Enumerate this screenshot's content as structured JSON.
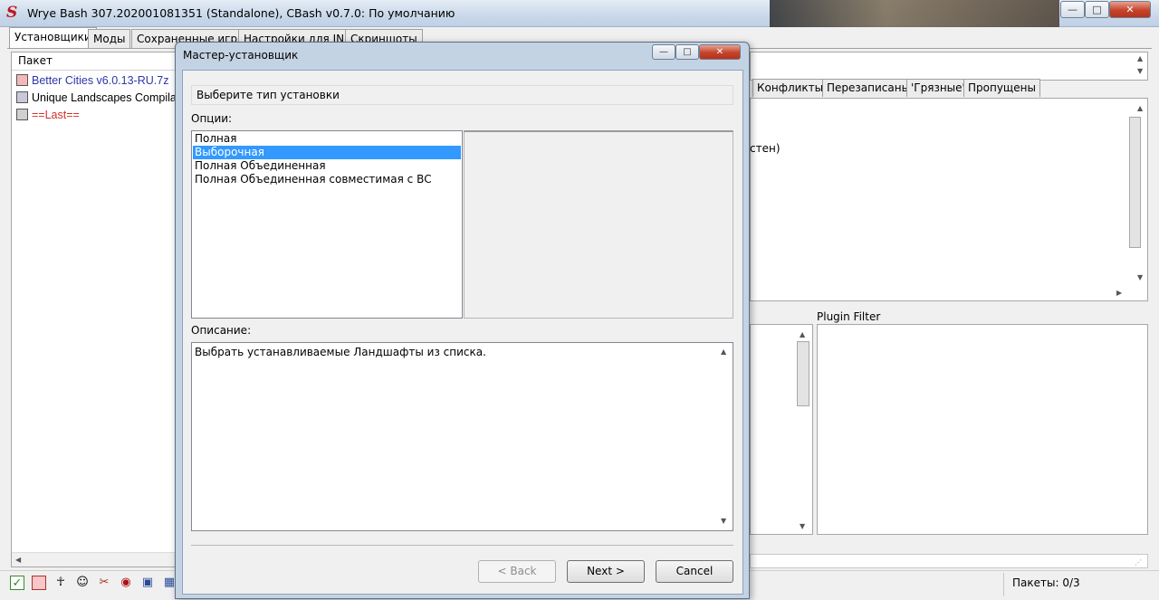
{
  "window": {
    "title": "Wrye Bash 307.202001081351 (Standalone), CBash v0.7.0: По умолчанию",
    "minimize": "—",
    "maximize": "□",
    "close": "✕"
  },
  "tabs": [
    "Установщики",
    "Моды",
    "Сохраненные игры",
    "Настройки для INI",
    "Скриншоты"
  ],
  "packages": {
    "header": "Пакет",
    "items": [
      {
        "name": "Better Cities v6.0.13-RU.7z",
        "color": "#2e36a8"
      },
      {
        "name": "Unique Landscapes Compila",
        "color": "#000000"
      },
      {
        "name": "==Last==",
        "color": "#d0302a"
      }
    ]
  },
  "right_tabs": [
    "Конфликты",
    "Перезаписаны",
    "'Грязные'",
    "Пропущены"
  ],
  "right_partial_text": "стен)",
  "plugin_filter_label": "Plugin Filter",
  "status": {
    "packages_count": "Пакеты: 0/3"
  },
  "toolbar_icons": [
    "checkbox-icon",
    "color-box-icon",
    "oblivion-icon",
    "person-icon",
    "tools-icon",
    "target-icon",
    "boss-icon",
    "tes4-icon"
  ],
  "dialog": {
    "title": "Мастер-установщик",
    "install_type_prompt": "Выберите тип установки",
    "options_label": "Опции:",
    "options": [
      {
        "label": "Полная",
        "selected": false
      },
      {
        "label": "Выборочная",
        "selected": true
      },
      {
        "label": "Полная Объединенная",
        "selected": false
      },
      {
        "label": "Полная Объединенная совместимая с ВС",
        "selected": false
      }
    ],
    "description_label": "Описание:",
    "description_text": "Выбрать устанавливаемые Ландшафты из списка.",
    "buttons": {
      "back": "< Back",
      "next": "Next >",
      "cancel": "Cancel"
    }
  }
}
